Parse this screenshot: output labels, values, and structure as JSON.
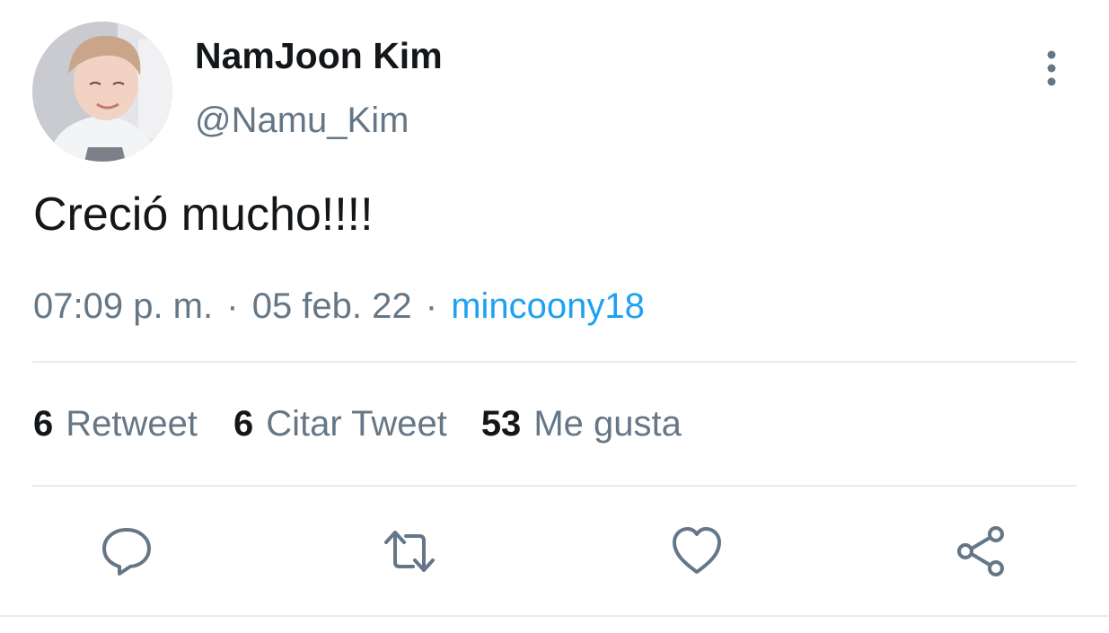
{
  "tweet": {
    "author": {
      "display_name": "NamJoon Kim",
      "handle": "@Namu_Kim"
    },
    "text": "Creció mucho!!!!",
    "meta": {
      "time": "07:09 p. m.",
      "separator": "·",
      "date": "05 feb. 22",
      "source": "mincoony18"
    },
    "stats": {
      "retweets": {
        "count": "6",
        "label": "Retweet"
      },
      "quotes": {
        "count": "6",
        "label": "Citar Tweet"
      },
      "likes": {
        "count": "53",
        "label": "Me gusta"
      }
    }
  },
  "colors": {
    "text_primary": "#14171a",
    "text_secondary": "#657786",
    "link": "#1da1f2",
    "divider": "#e6ecf0"
  },
  "icons": {
    "more": "vertical-ellipsis-icon",
    "reply": "speech-bubble-icon",
    "retweet": "retweet-arrows-icon",
    "like": "heart-icon",
    "share": "share-nodes-icon"
  }
}
